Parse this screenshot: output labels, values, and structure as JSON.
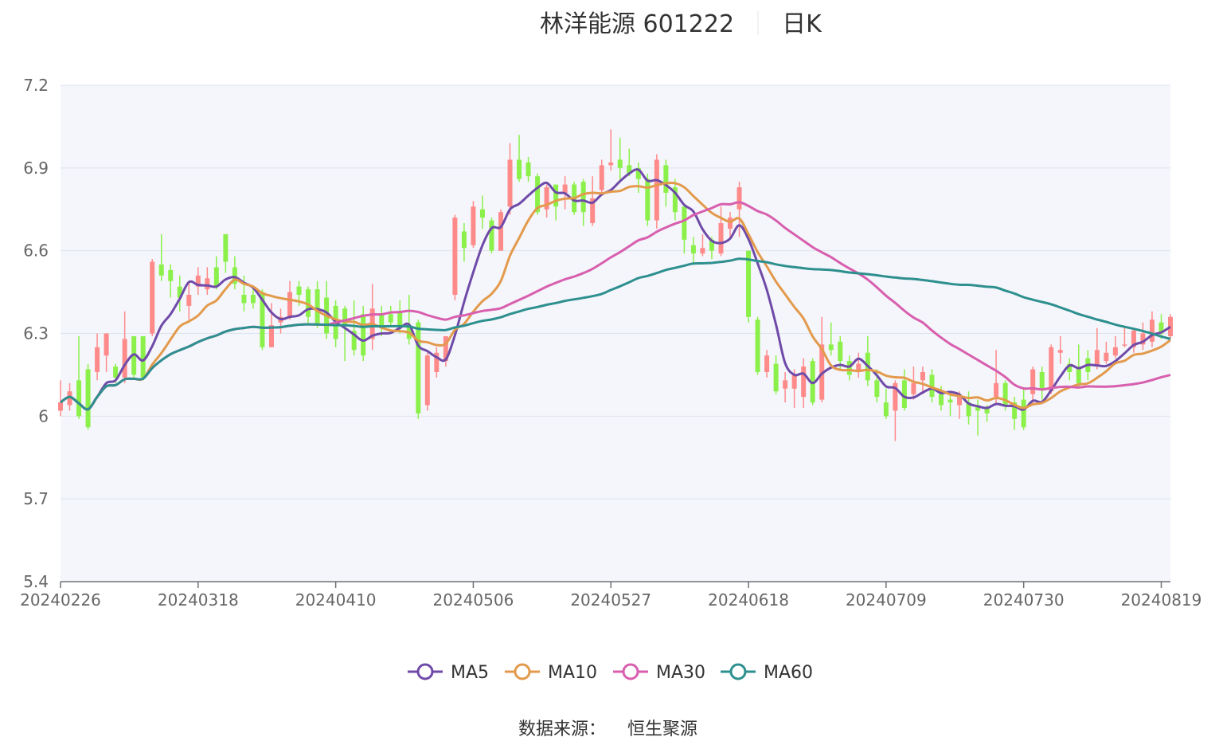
{
  "title": {
    "name": "林洋能源 601222",
    "period": "日K"
  },
  "source": {
    "label": "数据来源：",
    "value": "恒生聚源"
  },
  "colors": {
    "up": "#ff8a8a",
    "down": "#8cf04a",
    "MA5": "#6f4aa8",
    "MA10": "#e39a4c",
    "MA30": "#d85fae",
    "MA60": "#2e8f8f",
    "plot_bg": "#f4f6fb",
    "grid": "#dde4ef",
    "axis": "#6e7079"
  },
  "chart_data": {
    "type": "candlestick",
    "ylim": [
      5.4,
      7.2
    ],
    "yticks": [
      "5.4",
      "5.7",
      "6",
      "6.3",
      "6.6",
      "6.9",
      "7.2"
    ],
    "xticks": [
      "20240226",
      "20240318",
      "20240410",
      "20240506",
      "20240527",
      "20240618",
      "20240709",
      "20240730",
      "20240819"
    ],
    "tick_index": [
      0,
      15,
      30,
      45,
      60,
      75,
      90,
      105,
      120
    ],
    "legend": [
      "MA5",
      "MA10",
      "MA30",
      "MA60"
    ],
    "candles": [
      [
        6.02,
        6.05,
        6.13,
        6.0
      ],
      [
        6.04,
        6.09,
        6.12,
        6.02
      ],
      [
        6.13,
        6.0,
        6.29,
        5.99
      ],
      [
        6.17,
        5.96,
        6.19,
        5.95
      ],
      [
        6.16,
        6.25,
        6.3,
        6.13
      ],
      [
        6.22,
        6.3,
        6.3,
        6.16
      ],
      [
        6.18,
        6.14,
        6.19,
        6.12
      ],
      [
        6.14,
        6.28,
        6.38,
        6.12
      ],
      [
        6.29,
        6.15,
        6.29,
        6.14
      ],
      [
        6.29,
        6.14,
        6.29,
        6.13
      ],
      [
        6.3,
        6.56,
        6.57,
        6.29
      ],
      [
        6.55,
        6.51,
        6.66,
        6.49
      ],
      [
        6.53,
        6.49,
        6.55,
        6.43
      ],
      [
        6.47,
        6.43,
        6.51,
        6.38
      ],
      [
        6.4,
        6.44,
        6.48,
        6.35
      ],
      [
        6.47,
        6.51,
        6.54,
        6.44
      ],
      [
        6.46,
        6.5,
        6.54,
        6.44
      ],
      [
        6.54,
        6.47,
        6.58,
        6.46
      ],
      [
        6.66,
        6.56,
        6.66,
        6.52
      ],
      [
        6.54,
        6.48,
        6.58,
        6.46
      ],
      [
        6.44,
        6.41,
        6.51,
        6.38
      ],
      [
        6.44,
        6.41,
        6.47,
        6.39
      ],
      [
        6.45,
        6.25,
        6.46,
        6.24
      ],
      [
        6.25,
        6.33,
        6.41,
        6.25
      ],
      [
        6.34,
        6.36,
        6.39,
        6.3
      ],
      [
        6.36,
        6.45,
        6.49,
        6.35
      ],
      [
        6.47,
        6.44,
        6.49,
        6.4
      ],
      [
        6.46,
        6.36,
        6.47,
        6.33
      ],
      [
        6.46,
        6.33,
        6.49,
        6.32
      ],
      [
        6.43,
        6.3,
        6.49,
        6.28
      ],
      [
        6.4,
        6.28,
        6.42,
        6.25
      ],
      [
        6.39,
        6.33,
        6.4,
        6.2
      ],
      [
        6.31,
        6.24,
        6.42,
        6.22
      ],
      [
        6.37,
        6.22,
        6.4,
        6.2
      ],
      [
        6.28,
        6.39,
        6.48,
        6.24
      ],
      [
        6.37,
        6.32,
        6.4,
        6.29
      ],
      [
        6.37,
        6.34,
        6.4,
        6.33
      ],
      [
        6.38,
        6.33,
        6.42,
        6.3
      ],
      [
        6.33,
        6.28,
        6.44,
        6.26
      ],
      [
        6.34,
        6.01,
        6.35,
        5.99
      ],
      [
        6.04,
        6.22,
        6.23,
        6.02
      ],
      [
        6.16,
        6.23,
        6.25,
        6.14
      ],
      [
        6.2,
        6.29,
        6.29,
        6.18
      ],
      [
        6.44,
        6.72,
        6.73,
        6.42
      ],
      [
        6.67,
        6.61,
        6.7,
        6.56
      ],
      [
        6.62,
        6.76,
        6.78,
        6.61
      ],
      [
        6.75,
        6.72,
        6.8,
        6.68
      ],
      [
        6.71,
        6.6,
        6.72,
        6.59
      ],
      [
        6.6,
        6.74,
        6.75,
        6.6
      ],
      [
        6.76,
        6.93,
        6.99,
        6.73
      ],
      [
        6.93,
        6.86,
        7.02,
        6.85
      ],
      [
        6.92,
        6.87,
        6.94,
        6.85
      ],
      [
        6.87,
        6.74,
        6.88,
        6.73
      ],
      [
        6.75,
        6.83,
        6.84,
        6.72
      ],
      [
        6.84,
        6.76,
        6.84,
        6.71
      ],
      [
        6.81,
        6.84,
        6.87,
        6.75
      ],
      [
        6.84,
        6.74,
        6.85,
        6.73
      ],
      [
        6.85,
        6.74,
        6.86,
        6.69
      ],
      [
        6.7,
        6.79,
        6.87,
        6.69
      ],
      [
        6.82,
        6.91,
        6.93,
        6.8
      ],
      [
        6.91,
        6.92,
        7.04,
        6.89
      ],
      [
        6.93,
        6.9,
        7.01,
        6.85
      ],
      [
        6.91,
        6.88,
        6.97,
        6.87
      ],
      [
        6.9,
        6.86,
        6.92,
        6.81
      ],
      [
        6.86,
        6.71,
        6.88,
        6.69
      ],
      [
        6.71,
        6.93,
        6.95,
        6.68
      ],
      [
        6.91,
        6.81,
        6.93,
        6.76
      ],
      [
        6.83,
        6.74,
        6.86,
        6.71
      ],
      [
        6.76,
        6.64,
        6.77,
        6.59
      ],
      [
        6.62,
        6.59,
        6.65,
        6.55
      ],
      [
        6.59,
        6.61,
        6.66,
        6.58
      ],
      [
        6.64,
        6.6,
        6.65,
        6.57
      ],
      [
        6.59,
        6.7,
        6.76,
        6.58
      ],
      [
        6.68,
        6.72,
        6.74,
        6.64
      ],
      [
        6.75,
        6.83,
        6.85,
        6.65
      ],
      [
        6.6,
        6.36,
        6.6,
        6.34
      ],
      [
        6.35,
        6.16,
        6.36,
        6.15
      ],
      [
        6.16,
        6.22,
        6.24,
        6.14
      ],
      [
        6.19,
        6.09,
        6.22,
        6.08
      ],
      [
        6.1,
        6.13,
        6.16,
        6.05
      ],
      [
        6.1,
        6.15,
        6.17,
        6.03
      ],
      [
        6.07,
        6.18,
        6.21,
        6.03
      ],
      [
        6.2,
        6.05,
        6.21,
        6.04
      ],
      [
        6.06,
        6.26,
        6.36,
        6.05
      ],
      [
        6.26,
        6.24,
        6.34,
        6.22
      ],
      [
        6.27,
        6.2,
        6.29,
        6.17
      ],
      [
        6.2,
        6.15,
        6.22,
        6.13
      ],
      [
        6.16,
        6.19,
        6.23,
        6.14
      ],
      [
        6.23,
        6.13,
        6.29,
        6.11
      ],
      [
        6.13,
        6.07,
        6.17,
        6.05
      ],
      [
        6.05,
        6.0,
        6.1,
        5.99
      ],
      [
        6.02,
        6.12,
        6.13,
        5.91
      ],
      [
        6.13,
        6.03,
        6.17,
        6.02
      ],
      [
        6.08,
        6.12,
        6.18,
        6.06
      ],
      [
        6.13,
        6.16,
        6.18,
        6.08
      ],
      [
        6.15,
        6.07,
        6.17,
        6.05
      ],
      [
        6.08,
        6.04,
        6.11,
        6.02
      ],
      [
        6.06,
        6.05,
        6.08,
        6.0
      ],
      [
        6.04,
        6.07,
        6.09,
        5.99
      ],
      [
        6.05,
        6.0,
        6.09,
        5.97
      ],
      [
        6.04,
        6.02,
        6.06,
        5.93
      ],
      [
        6.03,
        6.01,
        6.04,
        5.98
      ],
      [
        6.07,
        6.12,
        6.24,
        6.04
      ],
      [
        6.12,
        6.04,
        6.13,
        6.02
      ],
      [
        6.05,
        5.99,
        6.07,
        5.95
      ],
      [
        6.06,
        5.96,
        6.1,
        5.95
      ],
      [
        6.08,
        6.17,
        6.18,
        6.04
      ],
      [
        6.16,
        6.1,
        6.18,
        6.06
      ],
      [
        6.09,
        6.25,
        6.26,
        6.08
      ],
      [
        6.23,
        6.24,
        6.29,
        6.19
      ],
      [
        6.19,
        6.16,
        6.21,
        6.13
      ],
      [
        6.18,
        6.12,
        6.26,
        6.1
      ],
      [
        6.21,
        6.16,
        6.24,
        6.13
      ],
      [
        6.18,
        6.24,
        6.32,
        6.17
      ],
      [
        6.2,
        6.23,
        6.27,
        6.19
      ],
      [
        6.22,
        6.25,
        6.29,
        6.21
      ],
      [
        6.26,
        6.26,
        6.32,
        6.25
      ],
      [
        6.25,
        6.31,
        6.32,
        6.23
      ],
      [
        6.26,
        6.3,
        6.34,
        6.24
      ],
      [
        6.27,
        6.35,
        6.38,
        6.25
      ],
      [
        6.34,
        6.3,
        6.37,
        6.28
      ],
      [
        6.29,
        6.36,
        6.37,
        6.28
      ]
    ]
  }
}
